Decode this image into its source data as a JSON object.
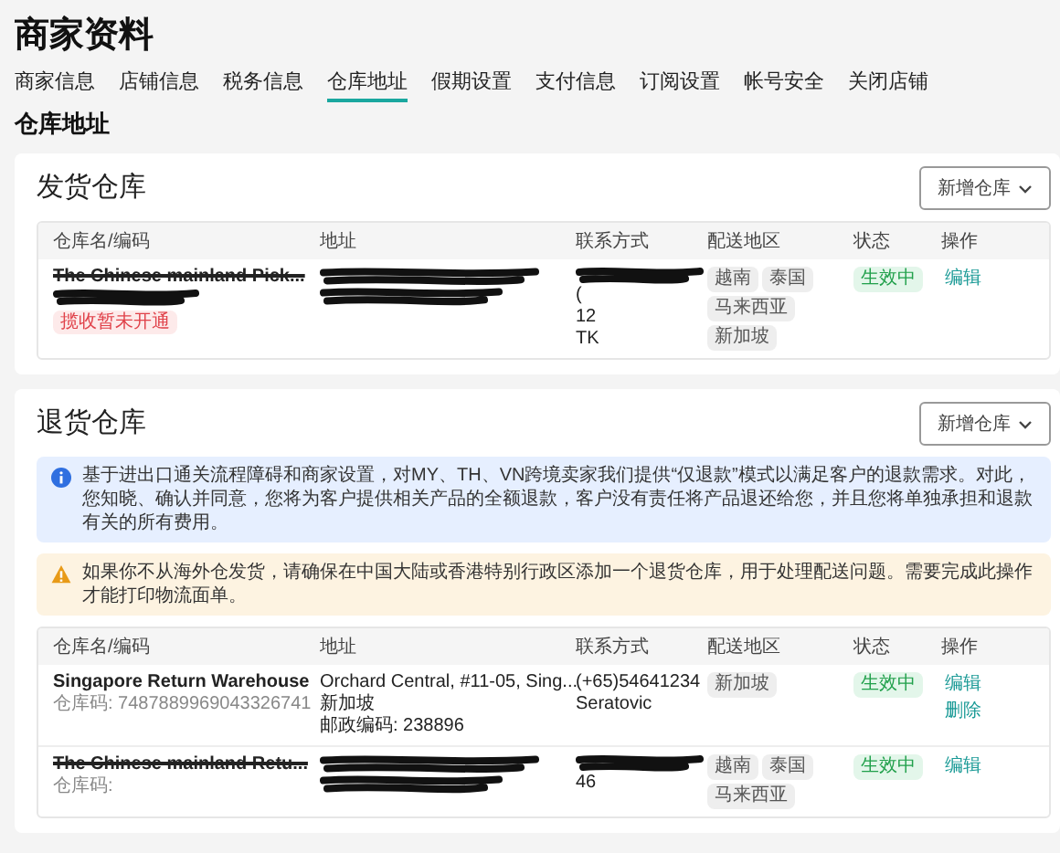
{
  "title": "商家资料",
  "tabs": [
    {
      "label": "商家信息",
      "selected": false
    },
    {
      "label": "店铺信息",
      "selected": false
    },
    {
      "label": "税务信息",
      "selected": false
    },
    {
      "label": "仓库地址",
      "selected": true
    },
    {
      "label": "假期设置",
      "selected": false
    },
    {
      "label": "支付信息",
      "selected": false
    },
    {
      "label": "订阅设置",
      "selected": false
    },
    {
      "label": "帐号安全",
      "selected": false
    },
    {
      "label": "关闭店铺",
      "selected": false
    }
  ],
  "section_title": "仓库地址",
  "sections": [
    {
      "title": "发货仓库",
      "add_button": "新增仓库",
      "columns": [
        "仓库名/编码",
        "地址",
        "联系方式",
        "配送地区",
        "状态",
        "操作"
      ],
      "rows": [
        {
          "redacted": true,
          "name": "The Chinese mainland Pick...",
          "badge": "揽收暂未开通",
          "address": [],
          "contact": [
            "(",
            "12",
            "TK"
          ],
          "regions": [
            "越南",
            "泰国",
            "马来西亚",
            "新加坡"
          ],
          "status": "生效中",
          "actions": [
            "编辑"
          ]
        }
      ]
    },
    {
      "title": "退货仓库",
      "add_button": "新增仓库",
      "notices": [
        {
          "kind": "info",
          "text": "基于进出口通关流程障碍和商家设置，对MY、TH、VN跨境卖家我们提供“仅退款”模式以满足客户的退款需求。对此，您知晓、确认并同意，您将为客户提供相关产品的全额退款，客户没有责任将产品退还给您，并且您将单独承担和退款有关的所有费用。"
        },
        {
          "kind": "warning",
          "text": "如果你不从海外仓发货，请确保在中国大陆或香港特别行政区添加一个退货仓库，用于处理配送问题。需要完成此操作才能打印物流面单。"
        }
      ],
      "columns": [
        "仓库名/编码",
        "地址",
        "联系方式",
        "配送地区",
        "状态",
        "操作"
      ],
      "rows": [
        {
          "redacted": false,
          "name": "Singapore Return Warehouse",
          "code": "仓库码: 7487889969043326741",
          "address": [
            "Orchard Central, #11-05, Sing...",
            "新加坡",
            "邮政编码: 238896"
          ],
          "contact": [
            "(+65)54641234",
            "Seratovic"
          ],
          "regions": [
            "新加坡"
          ],
          "status": "生效中",
          "actions": [
            "编辑",
            "删除"
          ]
        },
        {
          "redacted": true,
          "name": "The Chinese mainland Retu...",
          "code": "仓库码:",
          "address": [],
          "contact": [
            "46"
          ],
          "regions": [
            "越南",
            "泰国",
            "马来西亚"
          ],
          "status": "生效中",
          "actions": [
            "编辑"
          ]
        }
      ]
    }
  ]
}
